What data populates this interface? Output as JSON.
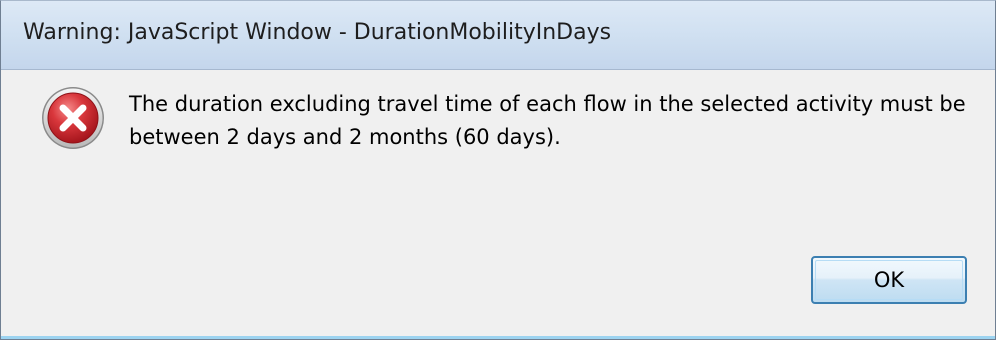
{
  "window": {
    "title": "Warning: JavaScript Window - DurationMobilityInDays"
  },
  "message": {
    "icon": "error-icon",
    "text": "The duration excluding travel time of each flow in the selected activity must be between 2 days and 2 months (60 days)."
  },
  "buttons": {
    "ok_label": "OK"
  },
  "colors": {
    "icon_red": "#c8252c",
    "button_border": "#3c7fb1"
  }
}
